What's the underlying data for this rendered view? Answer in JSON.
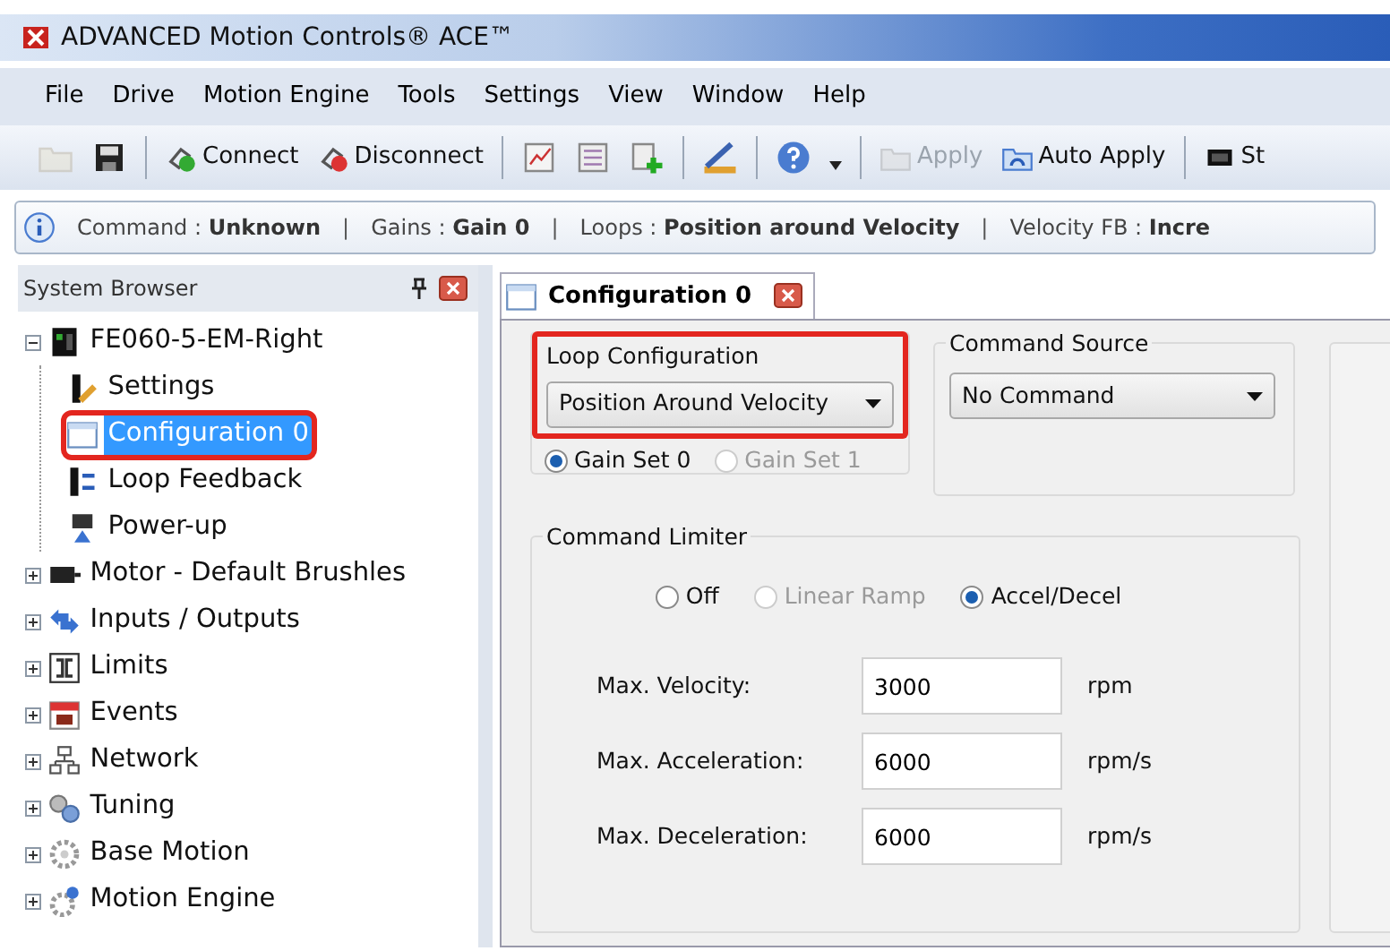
{
  "window": {
    "title": "ADVANCED Motion Controls® ACE™"
  },
  "menu": [
    "File",
    "Drive",
    "Motion Engine",
    "Tools",
    "Settings",
    "View",
    "Window",
    "Help"
  ],
  "toolbar": [
    {
      "kind": "icon",
      "disabled": true
    },
    {
      "kind": "icon",
      "disabled": false
    },
    {
      "kind": "separator"
    },
    {
      "kind": "button",
      "label": "Connect",
      "disabled": false
    },
    {
      "kind": "button",
      "label": "Disconnect",
      "disabled": false
    },
    {
      "kind": "separator"
    },
    {
      "kind": "icon",
      "disabled": false
    },
    {
      "kind": "icon",
      "disabled": false
    },
    {
      "kind": "icon",
      "disabled": false
    },
    {
      "kind": "separator"
    },
    {
      "kind": "icon",
      "disabled": false
    },
    {
      "kind": "separator"
    },
    {
      "kind": "icon",
      "disabled": false
    },
    {
      "kind": "dropdown"
    },
    {
      "kind": "separator"
    },
    {
      "kind": "button",
      "label": "Apply",
      "disabled": true
    },
    {
      "kind": "button",
      "label": "Auto Apply",
      "disabled": false
    },
    {
      "kind": "separator"
    },
    {
      "kind": "button",
      "label": "St",
      "disabled": false
    }
  ],
  "info_bar": [
    {
      "label": "Command :",
      "value": "Unknown"
    },
    {
      "divider": "|",
      "label": "Gains :",
      "value": "Gain 0"
    },
    {
      "divider": "|",
      "label": "Loops :",
      "value": "Position around Velocity"
    },
    {
      "divider": "|",
      "label": "Velocity FB :",
      "value": "Incre"
    }
  ],
  "sidebar": {
    "title": "System Browser",
    "tree": [
      {
        "label": "FE060-5-EM-Right",
        "selected": false,
        "highlighted": false,
        "expanded": true,
        "children": [
          {
            "label": "Settings",
            "selected": false,
            "highlighted": false
          },
          {
            "label": "Configuration 0",
            "selected": true,
            "highlighted": true
          },
          {
            "label": "Loop Feedback",
            "selected": false,
            "highlighted": false
          },
          {
            "label": "Power-up",
            "selected": false,
            "highlighted": false
          }
        ]
      },
      {
        "label": "Motor - Default Brushles",
        "selected": false,
        "highlighted": false,
        "expanded": false
      },
      {
        "label": "Inputs / Outputs",
        "selected": false,
        "highlighted": false,
        "expanded": false
      },
      {
        "label": "Limits",
        "selected": false,
        "highlighted": false,
        "expanded": false
      },
      {
        "label": "Events",
        "selected": false,
        "highlighted": false,
        "expanded": false
      },
      {
        "label": "Network",
        "selected": false,
        "highlighted": false,
        "expanded": false
      },
      {
        "label": "Tuning",
        "selected": false,
        "highlighted": false,
        "expanded": false
      },
      {
        "label": "Base Motion",
        "selected": false,
        "highlighted": false,
        "expanded": false
      },
      {
        "label": "Motion Engine",
        "selected": false,
        "highlighted": false,
        "expanded": false
      }
    ]
  },
  "tabs": [
    {
      "label": "Configuration 0",
      "selected": true
    }
  ],
  "loop_configuration": {
    "label": "Loop Configuration",
    "value": "Position Around Velocity",
    "highlighted": true,
    "gain_sets": [
      {
        "label": "Gain Set 0",
        "selected": true,
        "disabled": false
      },
      {
        "label": "Gain Set 1",
        "selected": false,
        "disabled": true
      }
    ]
  },
  "command_source": {
    "label": "Command Source",
    "value": "No Command"
  },
  "command_limiter": {
    "label": "Command Limiter",
    "options": [
      {
        "label": "Off",
        "selected": false,
        "disabled": false
      },
      {
        "label": "Linear Ramp",
        "selected": false,
        "disabled": true
      },
      {
        "label": "Accel/Decel",
        "selected": true,
        "disabled": false
      }
    ],
    "fields": [
      {
        "label": "Max. Velocity:",
        "value": "3000",
        "unit": "rpm"
      },
      {
        "label": "Max. Acceleration:",
        "value": "6000",
        "unit": "rpm/s"
      },
      {
        "label": "Max. Deceleration:",
        "value": "6000",
        "unit": "rpm/s"
      }
    ]
  }
}
